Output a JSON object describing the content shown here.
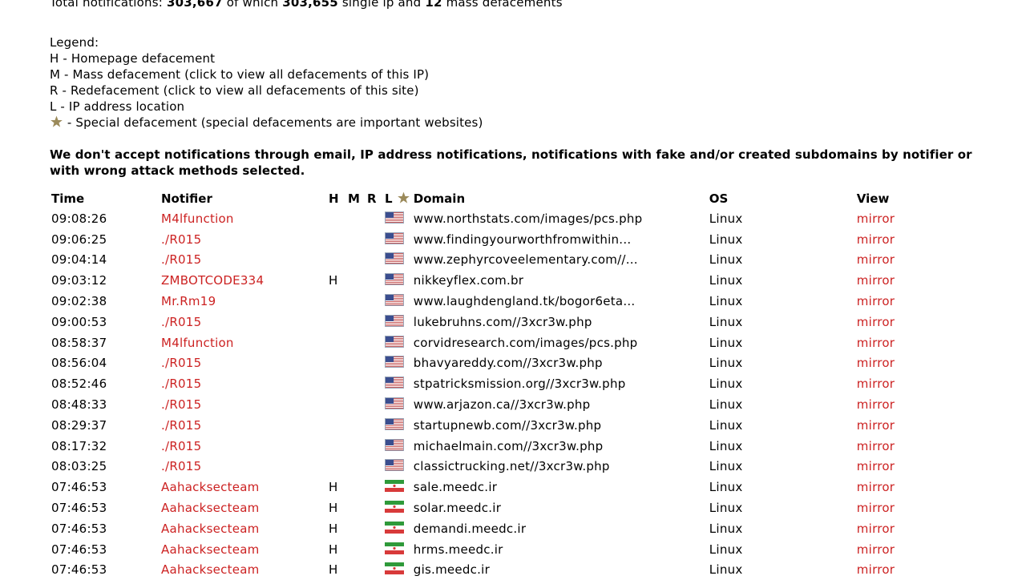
{
  "totals": {
    "prefix": "Total notifications: ",
    "total": "303,667",
    "mid": " of which ",
    "single": "303,655",
    "mid2": " single ip and ",
    "mass": "12",
    "suffix": " mass defacements"
  },
  "legend": {
    "title": "Legend:",
    "h": "H - Homepage defacement",
    "m": "M - Mass defacement (click to view all defacements of this IP)",
    "r": "R - Redefacement (click to view all defacements of this site)",
    "l": "L - IP address location",
    "special": " - Special defacement (special defacements are important websites)"
  },
  "notice": "We don't accept notifications through email, IP address notifications, notifications with fake and/or created subdomains by notifier or with wrong attack methods selected.",
  "table": {
    "headers": {
      "time": "Time",
      "notifier": "Notifier",
      "h": "H",
      "m": "M",
      "r": "R",
      "l": "L",
      "domain": "Domain",
      "os": "OS",
      "view": "View"
    },
    "rows": [
      {
        "time": "09:08:26",
        "notifier": "M4lfunction",
        "h": "",
        "flag": "us",
        "domain": "www.northstats.com/images/pcs.php",
        "os": "Linux",
        "view": "mirror"
      },
      {
        "time": "09:06:25",
        "notifier": "./R015",
        "h": "",
        "flag": "us",
        "domain": "www.findingyourworthfromwithin...",
        "os": "Linux",
        "view": "mirror"
      },
      {
        "time": "09:04:14",
        "notifier": "./R015",
        "h": "",
        "flag": "us",
        "domain": "www.zephyrcoveelementary.com//...",
        "os": "Linux",
        "view": "mirror"
      },
      {
        "time": "09:03:12",
        "notifier": "ZMBOTCODE334",
        "h": "H",
        "flag": "us",
        "domain": "nikkeyflex.com.br",
        "os": "Linux",
        "view": "mirror"
      },
      {
        "time": "09:02:38",
        "notifier": "Mr.Rm19",
        "h": "",
        "flag": "us",
        "domain": "www.laughdengland.tk/bogor6eta...",
        "os": "Linux",
        "view": "mirror"
      },
      {
        "time": "09:00:53",
        "notifier": "./R015",
        "h": "",
        "flag": "us",
        "domain": "lukebruhns.com//3xcr3w.php",
        "os": "Linux",
        "view": "mirror"
      },
      {
        "time": "08:58:37",
        "notifier": "M4lfunction",
        "h": "",
        "flag": "us",
        "domain": "corvidresearch.com/images/pcs.php",
        "os": "Linux",
        "view": "mirror"
      },
      {
        "time": "08:56:04",
        "notifier": "./R015",
        "h": "",
        "flag": "us",
        "domain": "bhavyareddy.com//3xcr3w.php",
        "os": "Linux",
        "view": "mirror"
      },
      {
        "time": "08:52:46",
        "notifier": "./R015",
        "h": "",
        "flag": "us",
        "domain": "stpatricksmission.org//3xcr3w.php",
        "os": "Linux",
        "view": "mirror"
      },
      {
        "time": "08:48:33",
        "notifier": "./R015",
        "h": "",
        "flag": "us",
        "domain": "www.arjazon.ca//3xcr3w.php",
        "os": "Linux",
        "view": "mirror"
      },
      {
        "time": "08:29:37",
        "notifier": "./R015",
        "h": "",
        "flag": "us",
        "domain": "startupnewb.com//3xcr3w.php",
        "os": "Linux",
        "view": "mirror"
      },
      {
        "time": "08:17:32",
        "notifier": "./R015",
        "h": "",
        "flag": "us",
        "domain": "michaelmain.com//3xcr3w.php",
        "os": "Linux",
        "view": "mirror"
      },
      {
        "time": "08:03:25",
        "notifier": "./R015",
        "h": "",
        "flag": "us",
        "domain": "classictrucking.net//3xcr3w.php",
        "os": "Linux",
        "view": "mirror"
      },
      {
        "time": "07:46:53",
        "notifier": "Aahacksecteam",
        "h": "H",
        "flag": "ir",
        "domain": "sale.meedc.ir",
        "os": "Linux",
        "view": "mirror"
      },
      {
        "time": "07:46:53",
        "notifier": "Aahacksecteam",
        "h": "H",
        "flag": "ir",
        "domain": "solar.meedc.ir",
        "os": "Linux",
        "view": "mirror"
      },
      {
        "time": "07:46:53",
        "notifier": "Aahacksecteam",
        "h": "H",
        "flag": "ir",
        "domain": "demandi.meedc.ir",
        "os": "Linux",
        "view": "mirror"
      },
      {
        "time": "07:46:53",
        "notifier": "Aahacksecteam",
        "h": "H",
        "flag": "ir",
        "domain": "hrms.meedc.ir",
        "os": "Linux",
        "view": "mirror"
      },
      {
        "time": "07:46:53",
        "notifier": "Aahacksecteam",
        "h": "H",
        "flag": "ir",
        "domain": "gis.meedc.ir",
        "os": "Linux",
        "view": "mirror"
      }
    ]
  },
  "icons": {
    "special": "star-icon",
    "flag_us": "us-flag-icon",
    "flag_ir": "iran-flag-icon"
  },
  "colors": {
    "link": "#cc2222",
    "star": "#9b8a5a"
  }
}
